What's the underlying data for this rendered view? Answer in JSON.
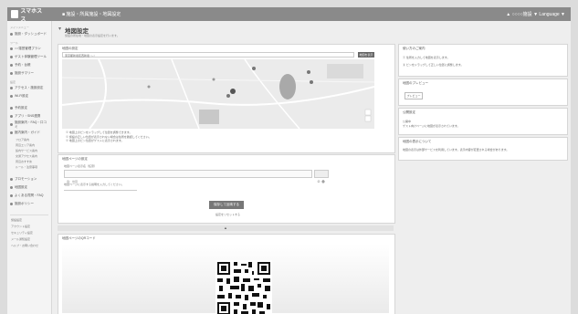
{
  "topbar": {
    "logo": "スマホスス",
    "breadcrumb": "■ 施設・所属施設・地図設定",
    "user": "▲ ○○○○施設 ▼  Language ▼"
  },
  "sidebar": {
    "section_1": "メインメニュー",
    "items": [
      {
        "label": "施設・ダッシュボード"
      },
      {
        "label": "○○運営管理プラン"
      },
      {
        "label": "ゲスト体験管理ツール"
      },
      {
        "label": "予約・台帳"
      },
      {
        "label": "施設サマリー"
      },
      {
        "label": "アクセス・施設設定"
      },
      {
        "label": "Wi-Fi設定"
      },
      {
        "label": "予約設定"
      },
      {
        "label": "アプリ・SNS連携"
      },
      {
        "label": "施設案内・FAQ・口コミ"
      },
      {
        "label": "館内案内・ガイド"
      },
      {
        "label": "プロモーション"
      },
      {
        "label": "地図設定"
      },
      {
        "label": "よくある質問・FAQ"
      },
      {
        "label": "施設ポリシー"
      }
    ],
    "section_2": "ツール",
    "section_3": "設定",
    "sub_items": [
      "フロア案内",
      "周辺エリア案内",
      "館内サービス案内",
      "交通アクセス案内",
      "周辺おすすめ",
      "ルール・注意事項"
    ],
    "footer_items": [
      "施設設定",
      "アカウント設定",
      "セキュリティ設定",
      "メール通知設定",
      "ヘルプ・お問い合わせ"
    ]
  },
  "header": {
    "title": "地図設定",
    "subtitle": "施設の所在地・地図の表示設定を行います。"
  },
  "map_panel": {
    "title": "地図の設定",
    "address_value": "東京都新宿区西新宿 ○−○",
    "search_button": "地図を表示",
    "notes": [
      "※ 地図上のピンをドラッグして位置を調整できます。",
      "※ 施設の正しい位置が表示されない場合は住所を確認してください。",
      "※ 地図上のピン位置がゲストに表示されます。"
    ]
  },
  "form_panel": {
    "title": "地図ページの設定",
    "field_1_label": "地図ページ表示名（任意）",
    "field_1_placeholder": "例：地図",
    "field_2_label": "地図ページの説明文（任意）",
    "field_2_placeholder": "地図ページに表示する説明を入力してください。",
    "submit_button": "保存して反映する",
    "reset_link": "設定をリセットする",
    "collapse_label": "▲"
  },
  "qr_panel": {
    "title": "地図ページのQRコード"
  },
  "right_panels": {
    "p1_title": "使い方のご案内",
    "p1_lines": [
      "① 住所を入力して地図を表示します。",
      "② ピンをドラッグして正しい位置に調整します。"
    ],
    "p2_title": "地図のプレビュー",
    "p2_button": "プレビュー",
    "p3_title": "公開設定",
    "p3_status": "公開中",
    "p3_desc": "ゲスト向けページに地図が表示されています。",
    "p4_title": "地図の表示について",
    "p4_desc": "地図の表示は外部サービスを利用しています。表示内容が変更される場合があります。"
  }
}
